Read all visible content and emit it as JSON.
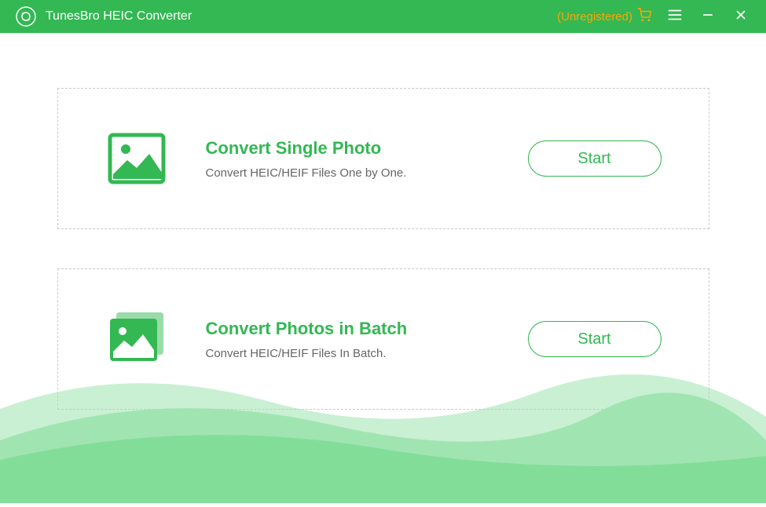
{
  "titlebar": {
    "app_title": "TunesBro HEIC Converter",
    "unregistered_label": "(Unregistered)"
  },
  "options": {
    "single": {
      "title": "Convert Single Photo",
      "subtitle": "Convert HEIC/HEIF Files One by One.",
      "button_label": "Start"
    },
    "batch": {
      "title": "Convert Photos in Batch",
      "subtitle": "Convert HEIC/HEIF Files In Batch.",
      "button_label": "Start"
    }
  },
  "colors": {
    "primary": "#33b853",
    "accent": "#ffa500"
  }
}
